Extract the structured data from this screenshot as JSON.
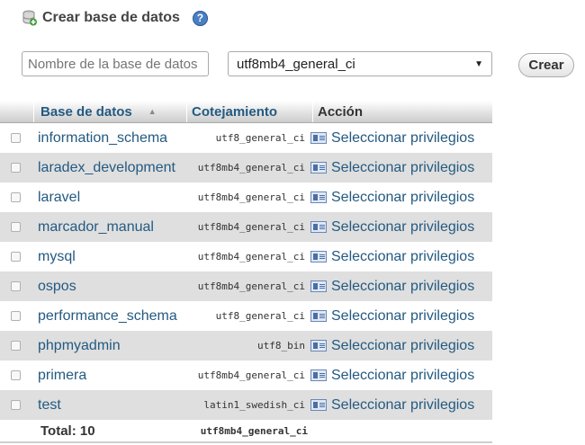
{
  "header": {
    "title": "Crear base de datos",
    "help_icon": "?",
    "db_icon": "database-add-icon"
  },
  "form": {
    "name_placeholder": "Nombre de la base de datos",
    "collation_value": "utf8mb4_general_ci",
    "create_label": "Crear"
  },
  "table": {
    "columns": {
      "database": "Base de datos",
      "collation": "Cotejamiento",
      "action": "Acción"
    },
    "rows": [
      {
        "name": "information_schema",
        "collation": "utf8_general_ci",
        "action": "Seleccionar privilegios"
      },
      {
        "name": "laradex_development",
        "collation": "utf8mb4_general_ci",
        "action": "Seleccionar privilegios"
      },
      {
        "name": "laravel",
        "collation": "utf8mb4_general_ci",
        "action": "Seleccionar privilegios"
      },
      {
        "name": "marcador_manual",
        "collation": "utf8mb4_general_ci",
        "action": "Seleccionar privilegios"
      },
      {
        "name": "mysql",
        "collation": "utf8mb4_general_ci",
        "action": "Seleccionar privilegios"
      },
      {
        "name": "ospos",
        "collation": "utf8mb4_general_ci",
        "action": "Seleccionar privilegios"
      },
      {
        "name": "performance_schema",
        "collation": "utf8_general_ci",
        "action": "Seleccionar privilegios"
      },
      {
        "name": "phpmyadmin",
        "collation": "utf8_bin",
        "action": "Seleccionar privilegios"
      },
      {
        "name": "primera",
        "collation": "utf8mb4_general_ci",
        "action": "Seleccionar privilegios"
      },
      {
        "name": "test",
        "collation": "latin1_swedish_ci",
        "action": "Seleccionar privilegios"
      }
    ],
    "footer": {
      "total_label": "Total: 10",
      "collation": "utf8mb4_general_ci"
    }
  }
}
